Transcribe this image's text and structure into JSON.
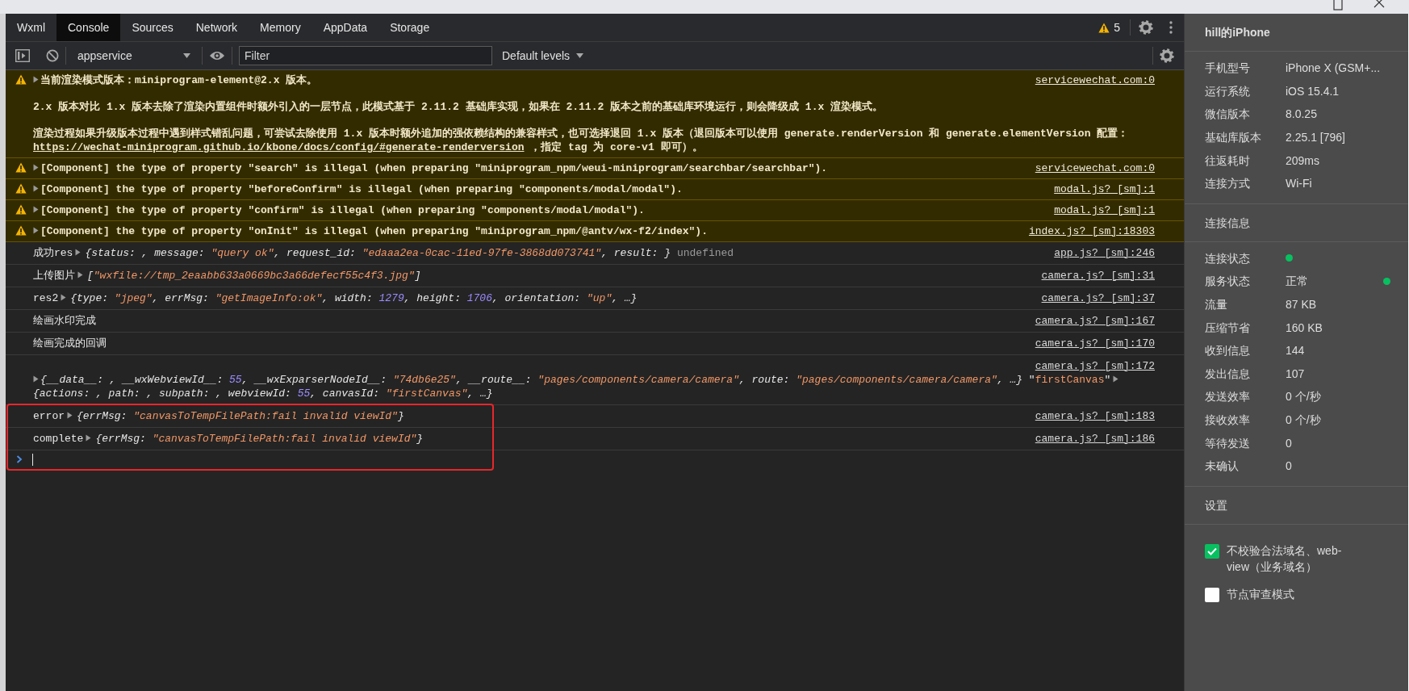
{
  "tabs": [
    {
      "label": "Wxml",
      "selected": false
    },
    {
      "label": "Console",
      "selected": true
    },
    {
      "label": "Sources",
      "selected": false
    },
    {
      "label": "Network",
      "selected": false
    },
    {
      "label": "Memory",
      "selected": false
    },
    {
      "label": "AppData",
      "selected": false
    },
    {
      "label": "Storage",
      "selected": false
    }
  ],
  "tab_bar": {
    "warning_count": "5"
  },
  "toolbar": {
    "context": "appservice",
    "filter": {
      "placeholder": "Filter"
    },
    "levels": "Default levels"
  },
  "console": {
    "messages": [
      {
        "kind": "warning",
        "source": "servicewechat.com:0",
        "highlighted": false,
        "paragraphs": [
          [
            {
              "kind": "toggle"
            },
            {
              "kind": "text",
              "text": "当前渲染模式版本：miniprogram-element@2.x 版本。"
            }
          ],
          [
            {
              "kind": "text",
              "text": "2.x 版本对比 1.x 版本去除了渲染内置组件时额外引入的一层节点，此模式基于 2.11.2 基础库实现，如果在 2.11.2 版本之前的基础库环境运行，则会降级成 1.x 渲染模式。"
            }
          ],
          [
            {
              "kind": "text",
              "text": "渲染过程如果升级版本过程中遇到样式错乱问题，可尝试去除使用 1.x 版本时额外追加的强依赖结构的兼容样式，也可选择退回 1.x 版本（退回版本可以使用 generate.renderVersion 和 generate.elementVersion 配置："
            },
            {
              "kind": "link",
              "text": "https://wechat-miniprogram.github.io/kbone/docs/config/#generate-renderversion"
            },
            {
              "kind": "text",
              "text": " ，指定 tag 为 core-v1 即可）。"
            }
          ]
        ]
      },
      {
        "kind": "warning",
        "source": "servicewechat.com:0",
        "highlighted": false,
        "paragraphs": [
          [
            {
              "kind": "toggle"
            },
            {
              "kind": "text",
              "text": "[Component] the type of property \"search\" is illegal (when preparing \"miniprogram_npm/weui-miniprogram/searchbar/searchbar\")."
            }
          ]
        ]
      },
      {
        "kind": "warning",
        "source": "modal.js? [sm]:1",
        "highlighted": false,
        "paragraphs": [
          [
            {
              "kind": "toggle"
            },
            {
              "kind": "text",
              "text": "[Component] the type of property \"beforeConfirm\" is illegal (when preparing \"components/modal/modal\")."
            }
          ]
        ]
      },
      {
        "kind": "warning",
        "source": "modal.js? [sm]:1",
        "highlighted": false,
        "paragraphs": [
          [
            {
              "kind": "toggle"
            },
            {
              "kind": "text",
              "text": "[Component] the type of property \"confirm\" is illegal (when preparing \"components/modal/modal\")."
            }
          ]
        ]
      },
      {
        "kind": "warning",
        "source": "index.js? [sm]:18303",
        "highlighted": false,
        "paragraphs": [
          [
            {
              "kind": "toggle"
            },
            {
              "kind": "text",
              "text": "[Component] the type of property \"onInit\" is illegal (when preparing \"miniprogram_npm/@antv/wx-f2/index\")."
            }
          ]
        ]
      },
      {
        "kind": "log",
        "source": "app.js? [sm]:246",
        "highlighted": false,
        "paragraphs": [
          [
            {
              "kind": "text",
              "text": "成功res"
            },
            {
              "kind": "toggle"
            },
            {
              "kind": "obj",
              "text": "{status: , message: "
            },
            {
              "kind": "string",
              "text": "\"query ok\""
            },
            {
              "kind": "obj",
              "text": ", request_id: "
            },
            {
              "kind": "string",
              "text": "\"edaaa2ea-0cac-11ed-97fe-3868dd073741\""
            },
            {
              "kind": "obj",
              "text": ", result: }"
            },
            {
              "kind": "muted",
              "text": "undefined"
            }
          ]
        ]
      },
      {
        "kind": "log",
        "source": "camera.js? [sm]:31",
        "highlighted": false,
        "paragraphs": [
          [
            {
              "kind": "text",
              "text": "上传图片"
            },
            {
              "kind": "toggle"
            },
            {
              "kind": "obj",
              "text": "["
            },
            {
              "kind": "string",
              "text": "\"wxfile://tmp_2eaabb633a0669bc3a66defecf55c4f3.jpg\""
            },
            {
              "kind": "obj",
              "text": "]"
            }
          ]
        ]
      },
      {
        "kind": "log",
        "source": "camera.js? [sm]:37",
        "highlighted": false,
        "paragraphs": [
          [
            {
              "kind": "text",
              "text": "res2"
            },
            {
              "kind": "toggle"
            },
            {
              "kind": "obj",
              "text": "{type: "
            },
            {
              "kind": "string",
              "text": "\"jpeg\""
            },
            {
              "kind": "obj",
              "text": ", errMsg: "
            },
            {
              "kind": "string",
              "text": "\"getImageInfo:ok\""
            },
            {
              "kind": "obj",
              "text": ", width: "
            },
            {
              "kind": "number",
              "text": "1279"
            },
            {
              "kind": "obj",
              "text": ", height: "
            },
            {
              "kind": "number",
              "text": "1706"
            },
            {
              "kind": "obj",
              "text": ", orientation: "
            },
            {
              "kind": "string",
              "text": "\"up\""
            },
            {
              "kind": "obj",
              "text": ", …}"
            }
          ]
        ]
      },
      {
        "kind": "log",
        "source": "camera.js? [sm]:167",
        "highlighted": false,
        "paragraphs": [
          [
            {
              "kind": "text",
              "text": "绘画水印完成"
            }
          ]
        ]
      },
      {
        "kind": "log",
        "source": "camera.js? [sm]:170",
        "highlighted": false,
        "paragraphs": [
          [
            {
              "kind": "text",
              "text": "绘画完成的回调"
            }
          ]
        ]
      },
      {
        "kind": "log",
        "source": "camera.js? [sm]:172",
        "highlighted": false,
        "paragraphs": [
          [
            {
              "kind": "toggle"
            },
            {
              "kind": "obj",
              "text": "{__data__: , __wxWebviewId__: "
            },
            {
              "kind": "number",
              "text": "55"
            },
            {
              "kind": "obj",
              "text": ", __wxExparserNodeId__: "
            },
            {
              "kind": "string",
              "text": "\"74db6e25\""
            },
            {
              "kind": "obj",
              "text": ", __route__: "
            },
            {
              "kind": "string",
              "text": "\"pages/components/camera/camera\""
            },
            {
              "kind": "obj",
              "text": ", route: "
            },
            {
              "kind": "string",
              "text": "\"pages/components/camera/camera\""
            },
            {
              "kind": "obj",
              "text": ", …}"
            },
            {
              "kind": "text",
              "text": " \""
            },
            {
              "kind": "plainstring",
              "text": "firstCanvas"
            },
            {
              "kind": "text",
              "text": "\""
            },
            {
              "kind": "toggle"
            },
            {
              "kind": "obj",
              "text": "{actions: , path: , subpath: , webviewId: "
            },
            {
              "kind": "number",
              "text": "55"
            },
            {
              "kind": "obj",
              "text": ", canvasId: "
            },
            {
              "kind": "string",
              "text": "\"firstCanvas\""
            },
            {
              "kind": "obj",
              "text": ", …}"
            }
          ]
        ]
      },
      {
        "kind": "log",
        "source": "camera.js? [sm]:183",
        "highlighted": true,
        "paragraphs": [
          [
            {
              "kind": "text",
              "text": "error"
            },
            {
              "kind": "toggle"
            },
            {
              "kind": "obj",
              "text": "{errMsg: "
            },
            {
              "kind": "string",
              "text": "\"canvasToTempFilePath:fail invalid viewId\""
            },
            {
              "kind": "obj",
              "text": "}"
            }
          ]
        ]
      },
      {
        "kind": "log",
        "source": "camera.js? [sm]:186",
        "highlighted": true,
        "paragraphs": [
          [
            {
              "kind": "text",
              "text": "complete"
            },
            {
              "kind": "toggle"
            },
            {
              "kind": "obj",
              "text": "{errMsg: "
            },
            {
              "kind": "string",
              "text": "\"canvasToTempFilePath:fail invalid viewId\""
            },
            {
              "kind": "obj",
              "text": "}"
            }
          ]
        ]
      }
    ],
    "prompt": {
      "highlighted": true
    }
  },
  "device_panel": {
    "title": "hill的iPhone",
    "info": [
      {
        "label": "手机型号",
        "value": "iPhone X (GSM+..."
      },
      {
        "label": "运行系统",
        "value": "iOS 15.4.1"
      },
      {
        "label": "微信版本",
        "value": "8.0.25"
      },
      {
        "label": "基础库版本",
        "value": "2.25.1 [796]"
      },
      {
        "label": "往返耗时",
        "value": "209ms"
      },
      {
        "label": "连接方式",
        "value": "Wi-Fi"
      }
    ],
    "connection": {
      "title": "连接信息",
      "rows": [
        {
          "kind": "dot",
          "label": "连接状态",
          "color": "#07c160"
        },
        {
          "kind": "text_dot",
          "label": "服务状态",
          "value": "正常",
          "color": "#07c160"
        },
        {
          "kind": "text",
          "label": "流量",
          "value": "87 KB"
        },
        {
          "kind": "text",
          "label": "压缩节省",
          "value": "160 KB"
        },
        {
          "kind": "text",
          "label": "收到信息",
          "value": "144"
        },
        {
          "kind": "text",
          "label": "发出信息",
          "value": "107"
        },
        {
          "kind": "text",
          "label": "发送效率",
          "value": "0 个/秒"
        },
        {
          "kind": "text",
          "label": "接收效率",
          "value": "0 个/秒"
        },
        {
          "kind": "text",
          "label": "等待发送",
          "value": "0"
        },
        {
          "kind": "text",
          "label": "未确认",
          "value": "0"
        }
      ]
    },
    "settings": {
      "title": "设置",
      "options": [
        {
          "label": "不校验合法域名、web-view（业务域名）",
          "checked": true
        },
        {
          "label": "节点审查模式",
          "checked": false
        }
      ]
    }
  }
}
